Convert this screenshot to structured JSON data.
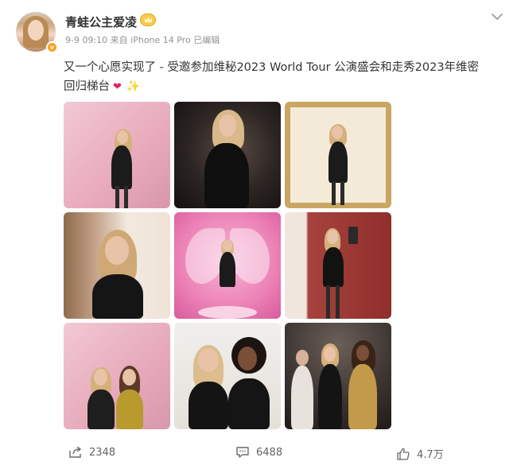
{
  "post": {
    "author_name": "青蛙公主爱凌",
    "meta": "9-9 09:10  来自 iPhone 14 Pro 已编辑",
    "text_line1": "又一个心愿实现了 - 受邀参加维秘2023 World Tour 公演盛会和走秀2023年维密",
    "text_line2": "回归梯台",
    "photos": [
      "pink backdrop portrait",
      "dark backdrop portrait",
      "gold frame portrait",
      "mirror selfie portrait",
      "pink wings portrait",
      "red wall portrait",
      "pink backdrop duo",
      "white backdrop duo",
      "group portrait"
    ]
  },
  "actions": {
    "share_count": "2348",
    "comment_count": "6488",
    "like_count": "4.7万"
  },
  "icons": {
    "share": "share-icon",
    "comment": "comment-icon",
    "like": "like-icon",
    "more": "chevron-down-icon",
    "verified": "verified-icon",
    "member": "crown-badge-icon"
  },
  "colors": {
    "meta_gray": "#939393",
    "heart": "#e0245e",
    "sparkle": "#f5b400",
    "verified_orange": "#f7a21b"
  }
}
